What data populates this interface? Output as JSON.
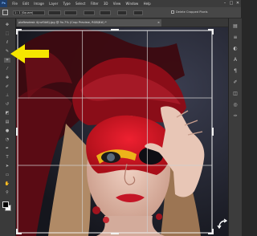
{
  "menubar": {
    "logo": "Ps",
    "items": [
      "File",
      "Edit",
      "Image",
      "Layer",
      "Type",
      "Select",
      "Filter",
      "3D",
      "View",
      "Window",
      "Help"
    ],
    "window_controls": [
      "–",
      "□",
      "✕"
    ]
  },
  "options_bar": {
    "ratio_value": "1 : 1 (Square)",
    "delete_cropped_label": "Delete Cropped Pixels"
  },
  "document_tab": {
    "title": "plaftesdesk 4(ruf0A6).jpg @ 9x.7% (Crop Preview, RGB/8#) *",
    "close_glyph": "×"
  },
  "tools": [
    {
      "icon": "move-icon",
      "glyph": "✥"
    },
    {
      "icon": "marquee-icon",
      "glyph": "⬚"
    },
    {
      "icon": "lasso-icon",
      "glyph": "ℓ"
    },
    {
      "icon": "quick-select-icon",
      "glyph": "✎"
    },
    {
      "icon": "crop-icon",
      "glyph": "⌗"
    },
    {
      "icon": "eyedropper-icon",
      "glyph": "⁄"
    },
    {
      "icon": "healing-brush-icon",
      "glyph": "✚"
    },
    {
      "icon": "brush-icon",
      "glyph": "✐"
    },
    {
      "icon": "clone-stamp-icon",
      "glyph": "⊥"
    },
    {
      "icon": "history-brush-icon",
      "glyph": "↺"
    },
    {
      "icon": "eraser-icon",
      "glyph": "◩"
    },
    {
      "icon": "gradient-icon",
      "glyph": "▤"
    },
    {
      "icon": "blur-icon",
      "glyph": "●"
    },
    {
      "icon": "dodge-icon",
      "glyph": "◔"
    },
    {
      "icon": "pen-icon",
      "glyph": "✒"
    },
    {
      "icon": "type-icon",
      "glyph": "T"
    },
    {
      "icon": "path-select-icon",
      "glyph": "➤"
    },
    {
      "icon": "shape-icon",
      "glyph": "▭"
    },
    {
      "icon": "hand-icon",
      "glyph": "✋"
    },
    {
      "icon": "zoom-icon",
      "glyph": "⚲"
    }
  ],
  "panel_icons": [
    {
      "icon": "history-panel-icon",
      "glyph": "▤"
    },
    {
      "icon": "properties-panel-icon",
      "glyph": "≡"
    },
    {
      "icon": "adjustments-panel-icon",
      "glyph": "◐"
    },
    {
      "icon": "character-panel-icon",
      "glyph": "A"
    },
    {
      "icon": "paragraph-panel-icon",
      "glyph": "¶"
    },
    {
      "icon": "brushes-panel-icon",
      "glyph": "✐"
    },
    {
      "icon": "layers-panel-icon",
      "glyph": "◫"
    },
    {
      "icon": "channels-panel-icon",
      "glyph": "◎"
    },
    {
      "icon": "paths-panel-icon",
      "glyph": "✑"
    }
  ],
  "colors": {
    "arrow": "#f5e600",
    "mask_red": "#d8141e",
    "headwrap": "#8a0d18"
  }
}
